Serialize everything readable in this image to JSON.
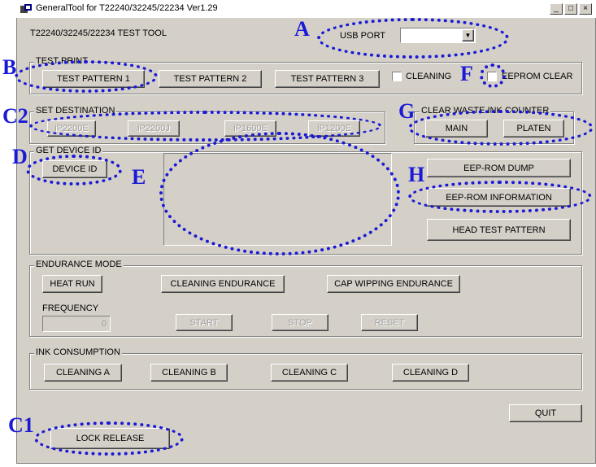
{
  "window": {
    "title": "GeneralTool for  T22240/32245/22234  Ver1.29",
    "minimize": "_",
    "maximize": "□",
    "close": "×"
  },
  "header": {
    "tool_title": "T22240/32245/22234  TEST TOOL",
    "usb_label": "USB PORT",
    "usb_value": ""
  },
  "test_print": {
    "legend": "TEST PRINT",
    "pattern1": "TEST PATTERN 1",
    "pattern2": "TEST PATTERN 2",
    "pattern3": "TEST PATTERN 3",
    "cleaning": "CLEANING",
    "eeprom_clear": "EEPROM CLEAR"
  },
  "set_destination": {
    "legend": "SET DESTINATION",
    "buttons": [
      "iP2200E",
      "iP2200J",
      "iP1600E",
      "iP1200E"
    ]
  },
  "clear_waste": {
    "legend": "CLEAR WASTE INK COUNTER",
    "main": "MAIN",
    "platen": "PLATEN"
  },
  "device": {
    "legend": "GET DEVICE ID",
    "device_id": "DEVICE ID",
    "output": ""
  },
  "eeprom": {
    "dump": "EEP-ROM DUMP",
    "information": "EEP-ROM INFORMATION",
    "head_test": "HEAD TEST PATTERN"
  },
  "endurance": {
    "legend": "ENDURANCE MODE",
    "heat_run": "HEAT RUN",
    "cleaning": "CLEANING ENDURANCE",
    "cap_wipping": "CAP WIPPING ENDURANCE",
    "frequency_label": "FREQUENCY",
    "frequency_value": "0",
    "start": "START",
    "stop": "STOP",
    "reset": "RESET"
  },
  "ink": {
    "legend": "INK CONSUMPTION",
    "a": "CLEANING A",
    "b": "CLEANING B",
    "c": "CLEANING C",
    "d": "CLEANING D"
  },
  "footer": {
    "quit": "QUIT",
    "lock_release": "LOCK RELEASE"
  },
  "annotations": {
    "A": "A",
    "B": "B",
    "C2": "C2",
    "D": "D",
    "E": "E",
    "F": "F",
    "G": "G",
    "H": "H",
    "C1": "C1"
  },
  "colors": {
    "annotation": "#1a1ad6",
    "face": "#d4d0c8"
  }
}
